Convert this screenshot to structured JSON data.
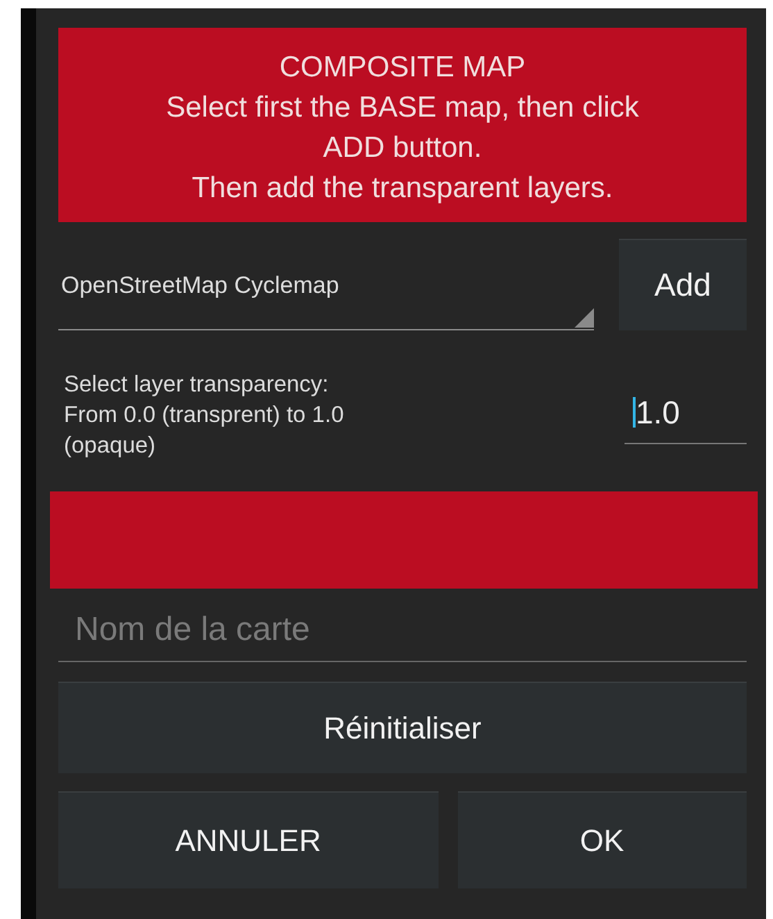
{
  "header": {
    "title": "COMPOSITE MAP",
    "lines": [
      "Select first the BASE map, then click",
      "ADD button.",
      "Then add the transparent layers."
    ]
  },
  "map_select": {
    "value": "OpenStreetMap Cyclemap"
  },
  "add_button": "Add",
  "transparency": {
    "label": [
      "Select layer transparency:",
      "From 0.0 (transprent) to 1.0",
      "(opaque)"
    ],
    "value": "1.0",
    "focused": true
  },
  "name_field": {
    "placeholder": "Nom de la carte"
  },
  "reset_button": "Réinitialiser",
  "buttons": [
    "ANNULER",
    "OK"
  ]
}
